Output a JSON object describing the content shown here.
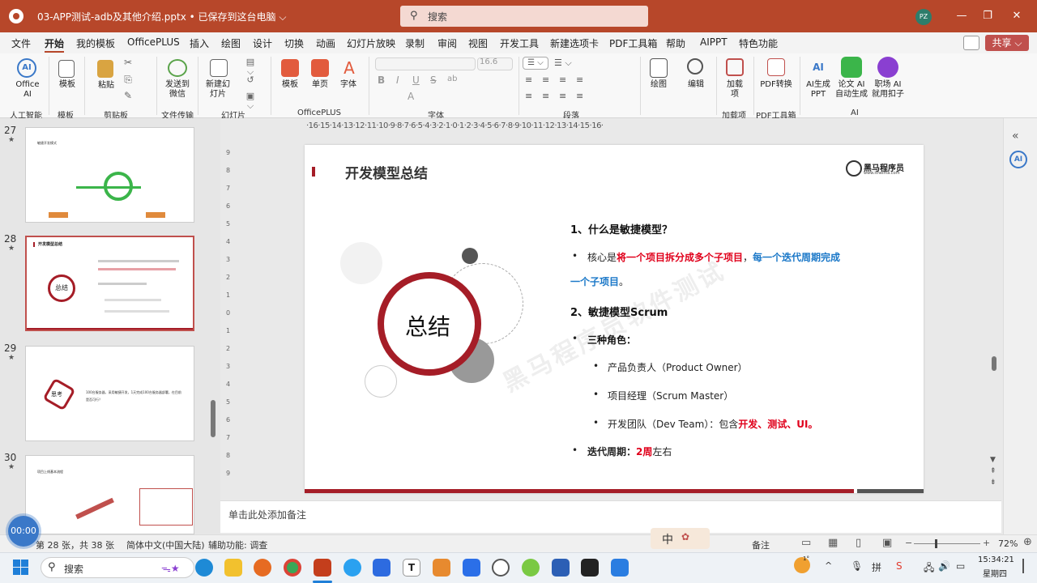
{
  "window": {
    "title": "03-APP测试-adb及其他介绍.pptx • 已保存到这台电脑 ⌵",
    "search_placeholder": "搜索",
    "user_initials": "PZ",
    "minimize": "—",
    "maximize": "❐",
    "close": "✕",
    "accent": "#b7472a"
  },
  "menu": {
    "items": [
      "文件",
      "开始",
      "我的模板",
      "OfficePLUS",
      "插入",
      "绘图",
      "设计",
      "切换",
      "动画",
      "幻灯片放映",
      "录制",
      "审阅",
      "视图",
      "开发工具",
      "新建选项卡",
      "PDF工具箱",
      "帮助",
      "AIPPT",
      "特色功能"
    ],
    "active": "开始",
    "share": "共享 ⌵"
  },
  "ribbon": {
    "office_ai": "Office AI",
    "template": "模板",
    "paste": "粘贴",
    "send_wechat": "发送到微信",
    "new_slide": "新建幻灯片",
    "template2": "模板",
    "single_page": "单页",
    "font_btn": "字体",
    "draw": "绘图",
    "edit": "编辑",
    "addins": "加载项",
    "pdf_convert": "PDF转换",
    "ai_ppt": "AI生成PPT",
    "paper_ai": "论文 AI 自动生成",
    "job_ai": "职场 AI 就用扣子",
    "font_size": "16.6",
    "format_buttons": [
      "B",
      "I",
      "U",
      "S",
      "ab",
      "A"
    ],
    "groups": [
      "人工智能",
      "模板",
      "剪贴板",
      "文件传输",
      "幻灯片",
      "OfficePLUS",
      "字体",
      "段落",
      "绘图",
      "加载项",
      "PDF工具箱",
      "AI"
    ]
  },
  "thumbnails": [
    {
      "num": "27",
      "star": "★",
      "title": "敏捷开发模式"
    },
    {
      "num": "28",
      "star": "★",
      "title": "开发模型总结",
      "center": "总结",
      "selected": true
    },
    {
      "num": "29",
      "star": "★",
      "title": "",
      "center": "思考",
      "body": "100台服务器，采用敏捷开发，1天完成100台服务器部署，在目前是否可行？"
    },
    {
      "num": "30",
      "star": "★",
      "title": "项目上线基本流程"
    }
  ],
  "ruler": {
    "horizontal": "·16·15·14·13·12·11·10·9·8·7·6·5·4·3·2·1·0·1·2·3·4·5·6·7·8·9·10·11·12·13·14·15·16·",
    "vertical": [
      "9",
      "8",
      "7",
      "6",
      "5",
      "4",
      "3",
      "2",
      "1",
      "0",
      "1",
      "2",
      "3",
      "4",
      "5",
      "6",
      "7",
      "8",
      "9"
    ]
  },
  "slide": {
    "title": "开发模型总结",
    "logo_text": "黑马程序员",
    "logo_sub": "www.itheima.com",
    "circle_text": "总结",
    "watermark": "黑马程序员软件测试",
    "heading1": "1、什么是敏捷模型？",
    "core_prefix": "核心是",
    "core_red": "将一个项目拆分成多个子项目",
    "core_comma": "，",
    "core_blue": "每一个迭代周期完成",
    "core_blue2": "一个子项目",
    "core_end": "。",
    "heading2": "2、敏捷模型Scrum",
    "roles_label": "三种角色：",
    "role1": "产品负责人（Product Owner）",
    "role2": "项目经理（Scrum Master）",
    "role3_prefix": "开发团队（Dev Team）：包含",
    "role3_red": "开发、测试、UI。",
    "iteration_label": "迭代周期：",
    "iteration_red": "2周",
    "iteration_suffix": "左右",
    "bullet": "•",
    "accent": "#a51d27"
  },
  "notes": {
    "placeholder": "单击此处添加备注"
  },
  "status": {
    "slide_count": "第 28 张，共 38 张",
    "language": "简体中文(中国大陆)",
    "accessibility": "辅助功能: 调查",
    "notes_btn": "备注",
    "zoom": "72%",
    "timer": "00:00",
    "ime": "中"
  },
  "taskbar": {
    "search": "搜索",
    "time": "15:34:21",
    "day": "星期四",
    "temp": "1°"
  }
}
